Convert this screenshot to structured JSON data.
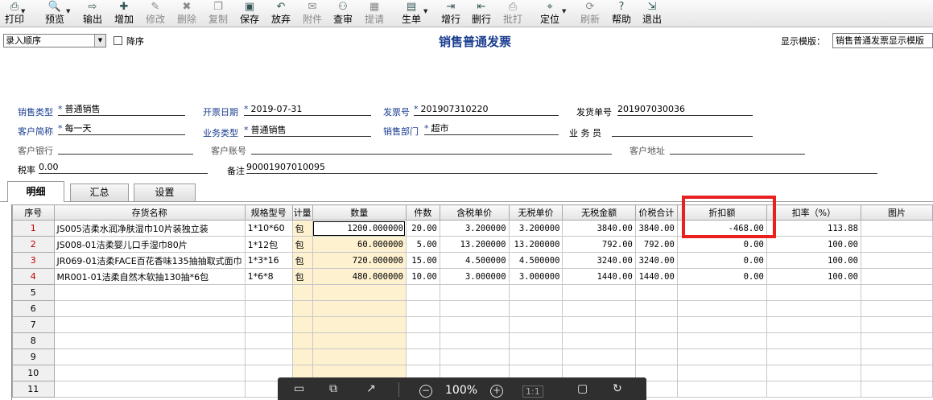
{
  "toolbar": [
    {
      "label": "打印",
      "icon": "printer-icon",
      "glyph": "⎙",
      "disabled": false,
      "caret": true
    },
    {
      "label": "预览",
      "icon": "preview-icon",
      "glyph": "🔍",
      "disabled": false,
      "caret": true
    },
    {
      "label": "输出",
      "icon": "export-icon",
      "glyph": "⇨",
      "disabled": false,
      "caret": false
    },
    {
      "label": "增加",
      "icon": "add-icon",
      "glyph": "✚",
      "disabled": false,
      "caret": false
    },
    {
      "label": "修改",
      "icon": "edit-icon",
      "glyph": "✎",
      "disabled": true,
      "caret": false
    },
    {
      "label": "删除",
      "icon": "delete-icon",
      "glyph": "✖",
      "disabled": true,
      "caret": false
    },
    {
      "label": "复制",
      "icon": "copy-icon",
      "glyph": "❐",
      "disabled": true,
      "caret": false
    },
    {
      "label": "保存",
      "icon": "save-icon",
      "glyph": "▣",
      "disabled": false,
      "caret": false
    },
    {
      "label": "放弃",
      "icon": "undo-icon",
      "glyph": "↶",
      "disabled": false,
      "caret": false
    },
    {
      "label": "附件",
      "icon": "attachment-icon",
      "glyph": "✉",
      "disabled": true,
      "caret": false
    },
    {
      "label": "查审",
      "icon": "binoculars-icon",
      "glyph": "⚇",
      "disabled": false,
      "caret": false
    },
    {
      "label": "提请",
      "icon": "submit-icon",
      "glyph": "▦",
      "disabled": true,
      "caret": false
    },
    {
      "label": "生单",
      "icon": "generate-icon",
      "glyph": "▤",
      "disabled": false,
      "caret": true
    },
    {
      "label": "增行",
      "icon": "add-row-icon",
      "glyph": "⇥",
      "disabled": false,
      "caret": false
    },
    {
      "label": "删行",
      "icon": "delete-row-icon",
      "glyph": "⇤",
      "disabled": false,
      "caret": false
    },
    {
      "label": "批打",
      "icon": "batch-print-icon",
      "glyph": "⎙",
      "disabled": true,
      "caret": false
    },
    {
      "label": "定位",
      "icon": "locate-icon",
      "glyph": "⌖",
      "disabled": false,
      "caret": true
    },
    {
      "label": "刷新",
      "icon": "refresh-icon",
      "glyph": "⟳",
      "disabled": true,
      "caret": false
    },
    {
      "label": "帮助",
      "icon": "help-icon",
      "glyph": "?",
      "disabled": false,
      "caret": false
    },
    {
      "label": "退出",
      "icon": "exit-icon",
      "glyph": "⇲",
      "disabled": false,
      "caret": false
    }
  ],
  "header": {
    "sort_value": "录入顺序",
    "desc_label": "降序",
    "title": "销售普通发票",
    "template_label": "显示模版：",
    "template_value": "销售普通发票显示模版"
  },
  "fields": {
    "sales_type_label": "销售类型",
    "sales_type": "普通销售",
    "invoice_date_label": "开票日期",
    "invoice_date": "2019-07-31",
    "invoice_no_label": "发票号",
    "invoice_no": "201907310220",
    "delivery_no_label": "发货单号",
    "delivery_no": "201907030036",
    "customer_label": "客户简称",
    "customer": "每一天",
    "business_type_label": "业务类型",
    "business_type": "普通销售",
    "department_label": "销售部门",
    "department": "超市",
    "salesperson_label": "业 务 员",
    "salesperson": "",
    "bank_label": "客户银行",
    "bank": "",
    "account_label": "客户账号",
    "account": "",
    "address_label": "客户地址",
    "address": "",
    "tax_label": "税率",
    "tax": "0.00",
    "remark_label": "备注",
    "remark": "90001907010095"
  },
  "tabs": [
    "明细",
    "汇总",
    "设置"
  ],
  "columns": [
    "序号",
    "存货名称",
    "规格型号",
    "计量",
    "数量",
    "件数",
    "含税单价",
    "无税单价",
    "无税金额",
    "价税合计",
    "折扣额",
    "扣率（%）",
    "图片"
  ],
  "rows": [
    {
      "no": "1",
      "name": "JS005洁柔水润净肤湿巾10片装独立装",
      "spec": "1*10*60",
      "unit": "包",
      "qty": "1200.000000",
      "pieces": "20.00",
      "price_tax": "3.200000",
      "price": "3.200000",
      "amount": "3840.00",
      "total": "3840.00",
      "discount": "-468.00",
      "rate": "113.88"
    },
    {
      "no": "2",
      "name": "JS008-01洁柔婴儿口手湿巾80片",
      "spec": "1*12包",
      "unit": "包",
      "qty": "60.000000",
      "pieces": "5.00",
      "price_tax": "13.200000",
      "price": "13.200000",
      "amount": "792.00",
      "total": "792.00",
      "discount": "0.00",
      "rate": "100.00"
    },
    {
      "no": "3",
      "name": "JR069-01洁柔FACE百花香味135抽抽取式面巾",
      "spec": "1*3*16",
      "unit": "包",
      "qty": "720.000000",
      "pieces": "15.00",
      "price_tax": "4.500000",
      "price": "4.500000",
      "amount": "3240.00",
      "total": "3240.00",
      "discount": "0.00",
      "rate": "100.00"
    },
    {
      "no": "4",
      "name": "MR001-01洁柔自然木软抽130抽*6包",
      "spec": "1*6*8",
      "unit": "包",
      "qty": "480.000000",
      "pieces": "10.00",
      "price_tax": "3.000000",
      "price": "3.000000",
      "amount": "1440.00",
      "total": "1440.00",
      "discount": "0.00",
      "rate": "100.00"
    }
  ],
  "empty_rows": [
    "5",
    "6",
    "7",
    "8",
    "9",
    "10",
    "11"
  ],
  "viewer": {
    "zoom": "100%",
    "ratio": "1:1"
  }
}
